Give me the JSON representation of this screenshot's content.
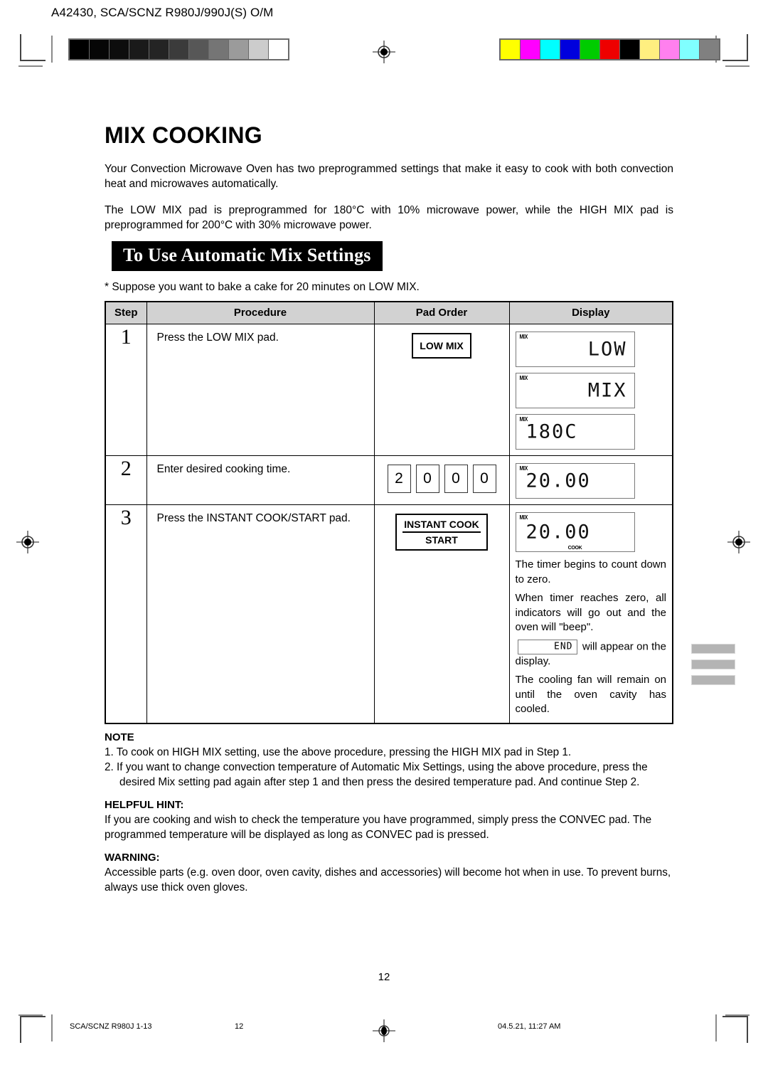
{
  "header": {
    "doc_code": "A42430, SCA/SCNZ R980J/990J(S) O/M",
    "gray_swatches": [
      "#000000",
      "#060606",
      "#0d0d0d",
      "#1a1a1a",
      "#242424",
      "#3b3b3b",
      "#575757",
      "#757575",
      "#9b9b9b",
      "#cccccc",
      "#ffffff"
    ],
    "color_swatches": [
      "#ffff00",
      "#ff00ff",
      "#00ffff",
      "#0000dd",
      "#00cc00",
      "#ee0000",
      "#000000",
      "#ffef80",
      "#ff80ee",
      "#80ffff",
      "#808080"
    ]
  },
  "main": {
    "title": "MIX COOKING",
    "paragraph_1": "Your Convection Microwave Oven has two preprogrammed settings that make it easy to cook with both convection heat and microwaves automatically.",
    "paragraph_2": "The LOW MIX pad is preprogrammed for 180°C with 10% microwave power, while the HIGH MIX pad is preprogrammed for 200°C with 30% microwave power.",
    "banner": "To Use Automatic Mix Settings",
    "suppose": "* Suppose you want to bake a cake for 20 minutes on LOW MIX."
  },
  "table": {
    "columns": [
      "Step",
      "Procedure",
      "Pad Order",
      "Display"
    ],
    "rows": [
      {
        "step": "1",
        "procedure": "Press  the LOW MIX pad.",
        "pad": {
          "type": "button",
          "label": "LOW MIX"
        },
        "displays": [
          {
            "indicator_top": "MIX",
            "text": "LOW",
            "align": "right"
          },
          {
            "indicator_top": "MIX",
            "text": "MIX",
            "align": "right"
          },
          {
            "indicator_top": "MIX",
            "text": "180C",
            "align": "left"
          }
        ]
      },
      {
        "step": "2",
        "procedure": "Enter desired cooking time.",
        "pad": {
          "type": "numpads",
          "keys": [
            "2",
            "0",
            "0",
            "0"
          ]
        },
        "displays": [
          {
            "indicator_top": "MIX",
            "text": "20.00",
            "align": "left"
          }
        ]
      },
      {
        "step": "3",
        "procedure": "Press the INSTANT COOK/START pad.",
        "pad": {
          "type": "button2",
          "line1": "INSTANT COOK",
          "line2": "START"
        },
        "displays": [
          {
            "indicator_top": "MIX",
            "indicator_bottom": "COOK",
            "text": "20.00",
            "align": "left"
          }
        ],
        "display_note_1": "The timer begins to  count down to zero.",
        "display_note_2": "When timer reaches zero, all indicators will go out and the oven will \"beep\".",
        "display_note_3_before": "",
        "display_note_3_lcd": "END",
        "display_note_3_after": " will appear on the display.",
        "display_note_4": "The cooling fan will remain on until the oven cavity has cooled."
      }
    ]
  },
  "notes": {
    "note_heading": "NOTE",
    "note_items": [
      "1. To cook on HIGH MIX setting, use the above procedure, pressing the HIGH MIX pad in Step 1.",
      "2. If you want to change convection temperature of Automatic Mix Settings, using the above procedure, press the desired Mix setting pad again after step 1 and then press the desired temperature pad. And continue Step 2."
    ],
    "hint_heading": "HELPFUL HINT:",
    "hint_text": "If you are cooking and wish to check the temperature you have programmed, simply press the CONVEC pad. The programmed temperature will be displayed as long as CONVEC pad is pressed.",
    "warning_heading": "WARNING:",
    "warning_text": "Accessible parts (e.g. oven door, oven cavity, dishes and accessories) will become hot when in use. To prevent burns, always use thick oven gloves."
  },
  "page_number": "12",
  "footer": {
    "left": "SCA/SCNZ R980J 1-13",
    "page": "12",
    "right": "04.5.21, 11:27 AM"
  }
}
